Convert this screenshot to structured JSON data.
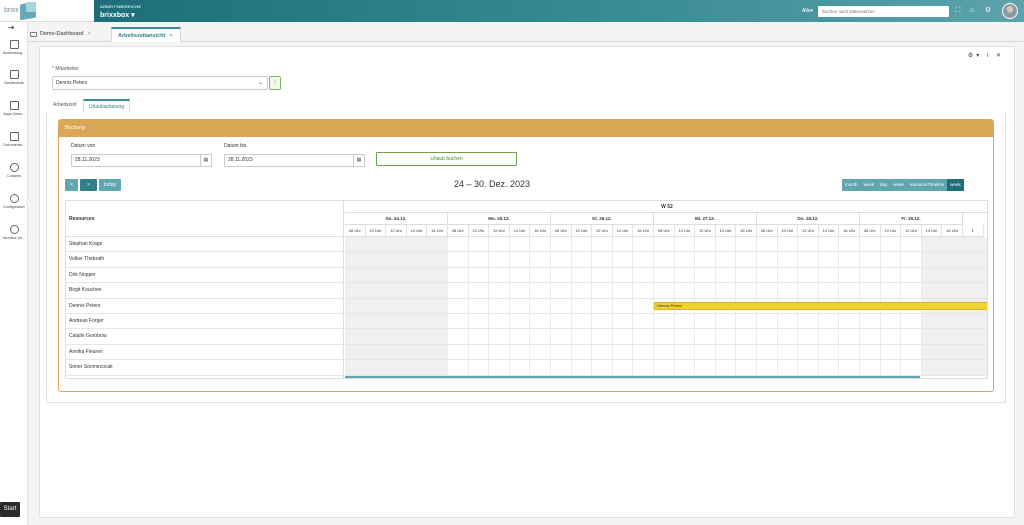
{
  "app": {
    "logo": "brixx",
    "area_label": "ARBEITSBEREICHE",
    "area_name": "brixxbox",
    "all_label": "Alle",
    "search_placeholder": "Suchen nach Datensatzen"
  },
  "sidebar": {
    "items": [
      {
        "label": "Anwendung...",
        "icon": "app-icon"
      },
      {
        "label": "Dashboards",
        "icon": "dashboard-icon"
      },
      {
        "label": "Apps (Admi...",
        "icon": "apps-icon"
      },
      {
        "label": "Dokumenta...",
        "icon": "doc-icon"
      },
      {
        "label": "Cockpits",
        "icon": "cockpit-icon"
      },
      {
        "label": "Konfiguration",
        "icon": "config-icon"
      },
      {
        "label": "brixxbox (Id...",
        "icon": "brixxbox-icon"
      }
    ],
    "start_label": "Start"
  },
  "tabs": [
    {
      "label": "Demo-Dashboard"
    },
    {
      "label": "Arbeitszeitansicht"
    }
  ],
  "form": {
    "mitarbeiter_label": "Mitarbeiter",
    "mitarbeiter_value": "Dennis Peters",
    "subtabs": [
      "Arbeitszeit",
      "Urlaubsplanung"
    ],
    "buchung_title": "Buchung",
    "datum_von_label": "Datum von",
    "datum_von": "28.11.2023",
    "datum_bis_label": "Datum bis",
    "datum_bis": "28.11.2023",
    "urlaub_button": "Urlaub buchen"
  },
  "calendar": {
    "title": "24 – 30. Dez. 2023",
    "today": "today",
    "prev": "<",
    "next": ">",
    "views": [
      "month",
      "week",
      "day",
      "week",
      "resourceTimeline",
      "week"
    ],
    "active_view_index": 5,
    "resources_header": "Resources",
    "week_label": "W 52",
    "days": [
      "So. 24.12.",
      "Mo. 25.12.",
      "Di. 26.12.",
      "Mi. 27.12.",
      "Do. 28.12.",
      "Fr. 29.12."
    ],
    "hours": [
      "08 Uhr",
      "10 Uhr",
      "12 Uhr",
      "14 Uhr",
      "16 Uhr"
    ],
    "resources": [
      "Stephan Krage",
      "Volker Thebrath",
      "Dirk Nopper",
      "Birgit Kouchen",
      "Dennis Peters",
      "Andreas Forger",
      "Catalin Goroboiu",
      "Annika Fleuren",
      "Soner Sönmezocak"
    ],
    "event": {
      "label": "Dennis Peters",
      "resource_index": 4,
      "start_day_index": 3,
      "color": "#f2d233"
    }
  },
  "colors": {
    "accent": "#3d8b95",
    "buchung": "#d9a756",
    "event": "#f2d233"
  }
}
